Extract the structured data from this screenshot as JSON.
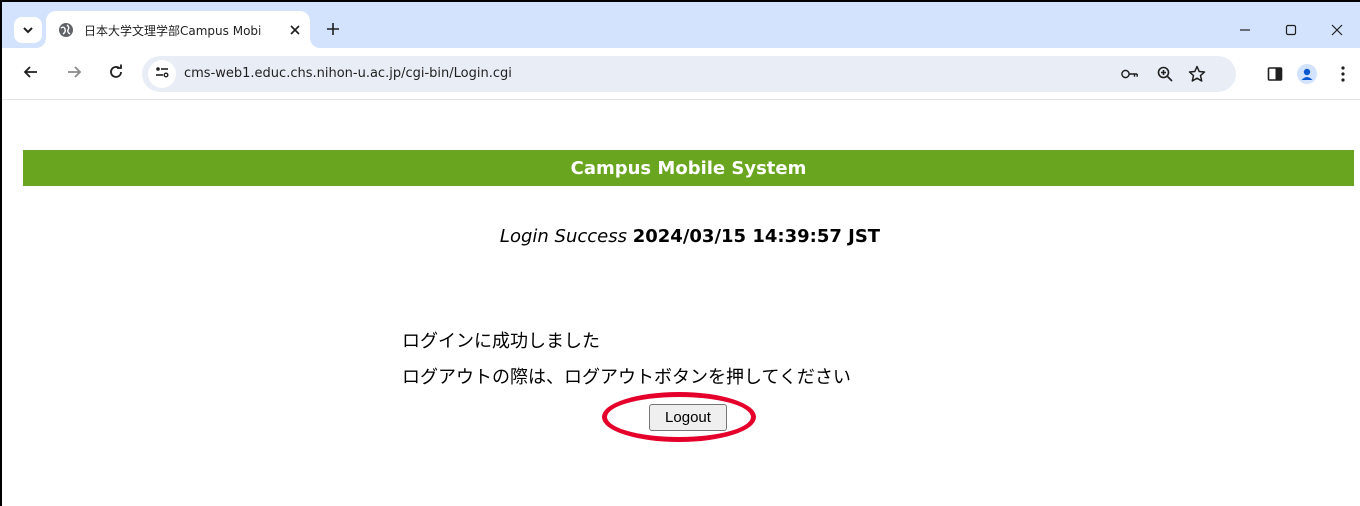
{
  "browser": {
    "tab": {
      "title": "日本大学文理学部Campus Mobi"
    },
    "address_bar": {
      "url": "cms-web1.educ.chs.nihon-u.ac.jp/cgi-bin/Login.cgi"
    },
    "icons": [
      "tab-search-icon",
      "globe-icon",
      "close-icon",
      "plus-icon",
      "minimize-icon",
      "maximize-icon",
      "window-close-icon",
      "back-icon",
      "forward-icon",
      "reload-icon",
      "site-info-icon",
      "key-icon",
      "zoom-icon",
      "star-icon",
      "side-panel-icon",
      "profile-icon",
      "menu-icon"
    ]
  },
  "page": {
    "banner_title": "Campus Mobile System",
    "login_label": "Login Success",
    "login_timestamp": "2024/03/15 14:39:57 JST",
    "message_line1": "ログインに成功しました",
    "message_line2": "ログアウトの際は、ログアウトボタンを押してください",
    "logout_button": "Logout"
  },
  "colors": {
    "banner": "#6aa51f",
    "tabstrip": "#d3e3fd",
    "highlight": "#e4002b"
  }
}
